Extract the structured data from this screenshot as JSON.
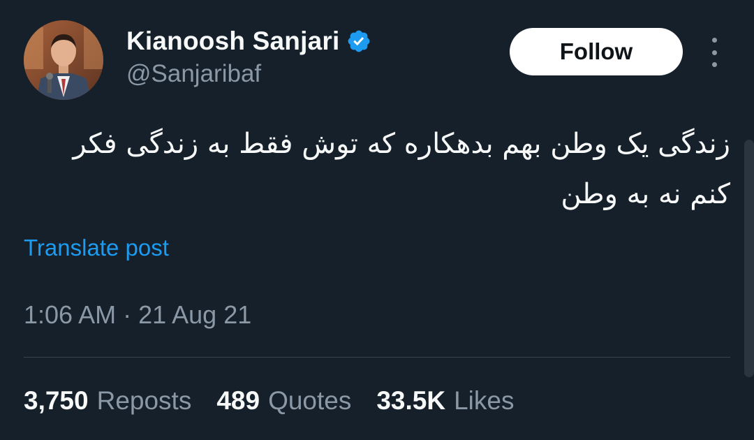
{
  "author": {
    "display_name": "Kianoosh Sanjari",
    "handle": "@Sanjaribaf",
    "verified": true,
    "avatar_icon": "profile-photo"
  },
  "follow_label": "Follow",
  "more_icon": "more-vertical-icon",
  "tweet": {
    "text_line_1": "زندگی یک وطن بهم بدهکاره که توش فقط به زندگی فکر",
    "text_line_2": "کنم نه به وطن",
    "translate_label": "Translate post",
    "timestamp": "1:06 AM · 21 Aug 21"
  },
  "stats": [
    {
      "count": "3,750",
      "label": "Reposts"
    },
    {
      "count": "489",
      "label": "Quotes"
    },
    {
      "count": "33.5K",
      "label": "Likes"
    }
  ],
  "colors": {
    "background": "#15202b",
    "text_primary": "#f7f9f9",
    "text_secondary": "#8b98a5",
    "link": "#1d9bf0",
    "verified": "#1d9bf0",
    "divider": "#38444d"
  }
}
